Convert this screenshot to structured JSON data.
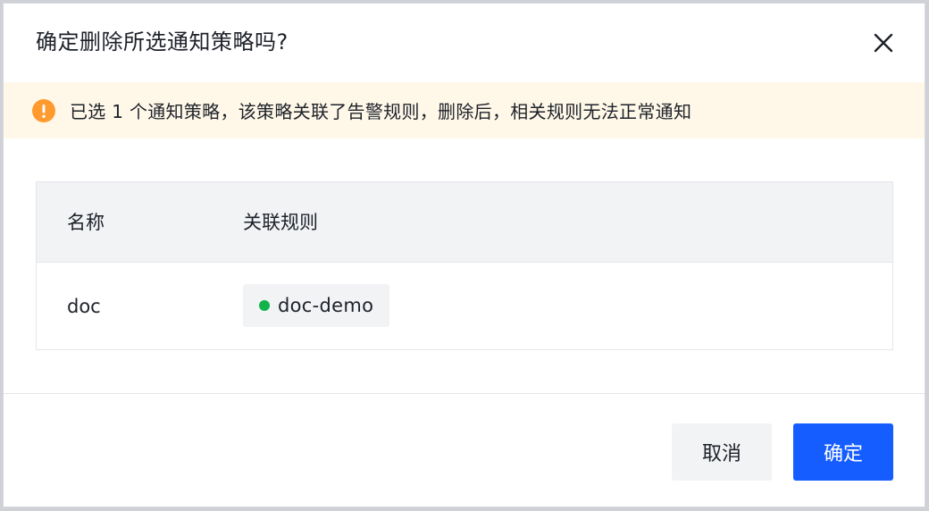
{
  "dialog": {
    "title": "确定删除所选通知策略吗?",
    "close_icon": "close-icon"
  },
  "alert": {
    "icon": "warning-circle-icon",
    "text": "已选 1 个通知策略，该策略关联了告警规则，删除后，相关规则无法正常通知"
  },
  "table": {
    "columns": [
      "名称",
      "关联规则"
    ],
    "rows": [
      {
        "name": "doc",
        "rule": {
          "label": "doc-demo",
          "status": "active"
        }
      }
    ]
  },
  "footer": {
    "cancel_label": "取消",
    "confirm_label": "确定"
  },
  "colors": {
    "primary": "#165dff",
    "warning": "#ff9a2e",
    "success_dot": "#12b34a",
    "alert_bg": "#fff8e8"
  }
}
